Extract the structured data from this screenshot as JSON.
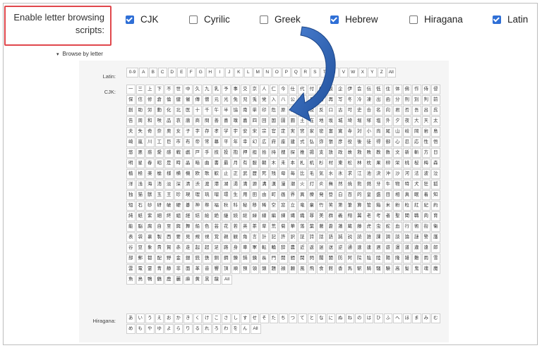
{
  "settings": {
    "enable_label": "Enable letter browsing scripts:",
    "scripts": [
      {
        "label": "CJK",
        "checked": true
      },
      {
        "label": "Cyrilic",
        "checked": false
      },
      {
        "label": "Greek",
        "checked": false
      },
      {
        "label": "Hebrew",
        "checked": true
      },
      {
        "label": "Hiragana",
        "checked": false
      },
      {
        "label": "Latin",
        "checked": true
      }
    ]
  },
  "browse": {
    "toggle_label": "Browse by letter",
    "latin_label": "Latin:",
    "cjk_label": "CJK:",
    "hiragana_label": "Hiragana:",
    "latin_letters": [
      "0-9",
      "A",
      "B",
      "C",
      "D",
      "E",
      "F",
      "G",
      "H",
      "I",
      "J",
      "K",
      "L",
      "M",
      "N",
      "O",
      "P",
      "Q",
      "R",
      "S",
      "T",
      "U",
      "V",
      "W",
      "X",
      "Y",
      "Z",
      "All"
    ],
    "cjk_chars": "一三上下不世中久九乳予事交京人仁今仕代付仙仮企伊会伝低住体佛作侍侵保信修倉倫健催傳僧元光免児兎党入八公共兵内再写冬冷凍出函分刑別判前創助労動化北医十千午半協南単印危原去参及反口古可史合名向君否吾呂呉告周和咲品哀唐商問善喜嗅嘉四回国園圓土在地坂城埼堀塚塩外夕夜大天太夫失奇奈奥女子字存孝学宇安宋宗官定実宮家密富寛寺対小尚尾山岐岡岩島崎嵐川工巨市布帝常幕平年幸幻広府座建式弘弥張彦役後徒得御心忍応性悟悠悪惑愛感戦戯戸手技投抱押担拾持捜探推揚支放政故救敗教数文新斬方日明星春昭是時晶暗曲書最月有服朝木未本札机杉村東松林枕果柳栄桃桜梅森植極楽槍様横機欧歌歓止正武歴死残母毎比毛気水氷求江池決沖沙河法波泣洋浅海消淡深清渋渡港湖湯満源溝漢漫潮火灯炎無然焼熊燃牙牛物特犬狂狐独猫獣玉王珍現理琉瑠環生用田由町画界異療発登白百的皇盛目相真眠着知短石砂研破硬碁神祭福秋科秘移稀空窓立竜童竹笑第筆算管箱米粉粒紅紀約純紙紫細終組経結絵絶継続総緑線編練縄織罪美群義翔翼老考者聖聞職肉育能脳腐自至興舞船色芸花若英茶草荒菊華落葉著蒼蓮蔵藤虎虫蛇血行術街衛表袋裏製西要見規視覚親観角言計記許訳証詩話語誠説読誰課調談論謎警護谷豆象貴賀赤走起超足路身車軍転輪辞農近返迷送逆通速連週遊運道違遠郎部郵都配野金銀銃鉄銅鋼錬鍋鏡長門開間関閃閣闇防阿院陰陸陽隆雑難雨雪雲電霊青静非面革音響頂順預領頭題顔願風飛食館香馬駅騎騒験高髪鬼魂魔魚鳥鴨鶴鹿麗麻黄黒龍",
    "hiragana_chars": [
      "あ",
      "い",
      "う",
      "え",
      "お",
      "か",
      "き",
      "く",
      "け",
      "こ",
      "さ",
      "し",
      "す",
      "せ",
      "そ",
      "た",
      "ち",
      "つ",
      "て",
      "と",
      "な",
      "に",
      "ぬ",
      "ね",
      "の",
      "は",
      "ひ",
      "ふ",
      "へ",
      "ほ",
      "ま",
      "み",
      "む",
      "め",
      "も",
      "や",
      "ゆ",
      "よ",
      "ら",
      "り",
      "る",
      "れ",
      "ろ",
      "わ",
      "を",
      "ん"
    ],
    "all_label": "All"
  },
  "colors": {
    "accent": "#2f6fd6",
    "highlight_border": "#e0474c",
    "panel_bg": "#f5f5f5"
  }
}
